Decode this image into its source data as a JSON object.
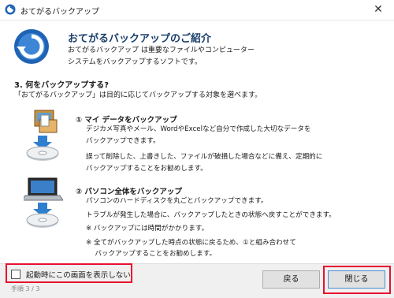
{
  "window": {
    "title": "おてがるバックアップ",
    "close_glyph": "✕"
  },
  "intro": {
    "heading": "おてがるバックアップのご紹介",
    "lines": [
      "おてがるバックアップ は重要なファイルやコンピューター",
      "システムをバックアップするソフトです。"
    ]
  },
  "question": {
    "title": "3. 何をバックアップする?",
    "description": "「おてがるバックアップ」は目的に応じてバックアップする対象を選べます。"
  },
  "section1": {
    "title": "① マイ データをバックアップ",
    "lines": [
      "デジカメ写真やメール、WordやExcelなど自分で作成した大切なデータを",
      "バックアップできます。"
    ],
    "lines2": [
      "誤って削除した、上書きした、ファイルが破損した場合などに備え、定期的に",
      "バックアップすることをお勧めします。"
    ]
  },
  "section2": {
    "title": "② パソコン全体をバックアップ",
    "lines": [
      "パソコンのハードディスクを丸ごとバックアップできます。",
      "トラブルが発生した場合に、バックアップしたときの状態へ戻すことができます。",
      "※ バックアップには時間がかかります。",
      "※ 全てがバックアップした時点の状態に戻るため、①と組み合わせて",
      "　 バックアップすることをお勧めします。"
    ]
  },
  "footer": {
    "checkbox_label": "起動時にこの画面を表示しない",
    "checkbox_checked": false,
    "step": "手順 3 / 3",
    "back_label": "戻る",
    "close_label": "閉じる"
  },
  "colors": {
    "highlight": "#e8102e",
    "heading": "#1a3f6b",
    "logo": "#1e63b4"
  },
  "icons": [
    "app-icon",
    "backup-logo-icon",
    "data-backup-icon",
    "pc-backup-icon"
  ]
}
